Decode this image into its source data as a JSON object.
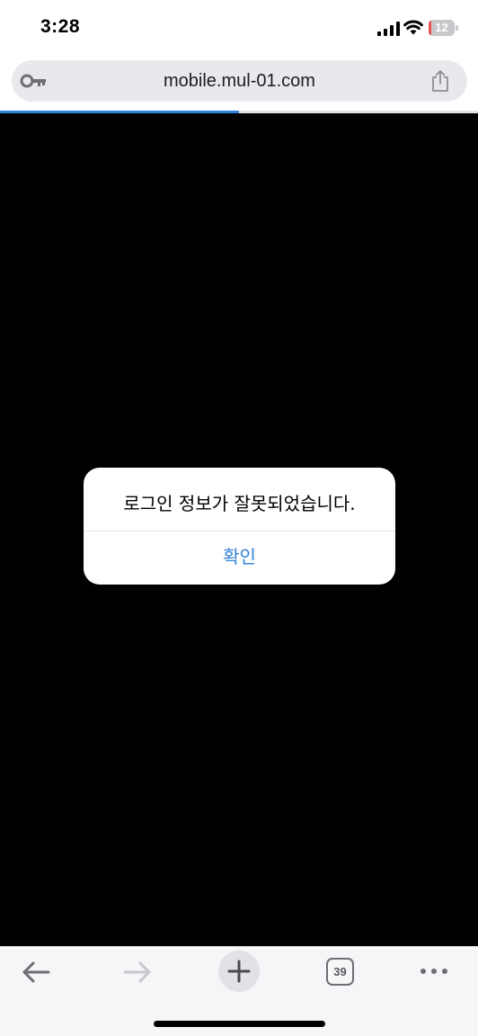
{
  "status_bar": {
    "time": "3:28",
    "battery_level": "12",
    "icons": [
      "cellular-signal-icon",
      "wifi-icon",
      "battery-icon"
    ]
  },
  "address_bar": {
    "url": "mobile.mul-01.com",
    "left_icon": "key-icon",
    "right_icon": "share-icon"
  },
  "page_load": {
    "progress_percent": 50
  },
  "alert": {
    "message": "로그인 정보가 잘못되었습니다.",
    "confirm_label": "확인"
  },
  "toolbar": {
    "back_icon": "back-arrow-icon",
    "forward_icon": "forward-arrow-icon",
    "new_tab_icon": "plus-icon",
    "tab_count": "39",
    "more_icon": "more-dots-icon"
  },
  "colors": {
    "accent": "#2f80d8",
    "battery_low": "#e9504b",
    "content_background": "#000000",
    "toolbar_background": "#f6f6f8"
  }
}
